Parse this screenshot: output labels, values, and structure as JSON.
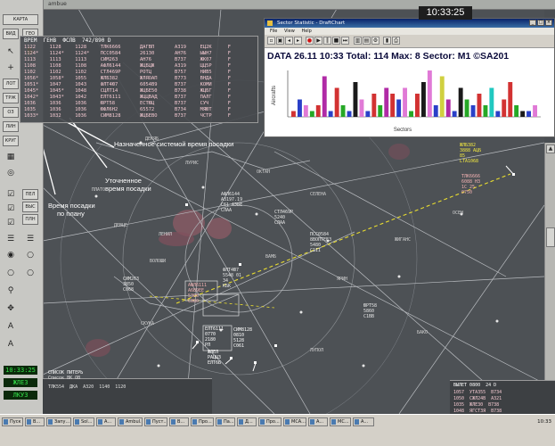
{
  "clock": "10:33:25",
  "top_bar": {
    "title": "ambue",
    "right": ""
  },
  "left_toolbar": {
    "buttons": [
      "КАРТА",
      "ВИД",
      "ГЕО",
      "ЛОТ",
      "ТРЖ",
      "ОЗ",
      "ЛИН",
      "КРУГ",
      "ПЕЛ",
      "ВЫС",
      "ПЛН"
    ],
    "clock_lines": [
      "10:33:25",
      "ЖЛЕЗ",
      "ЛКУЗ"
    ]
  },
  "landing_table": {
    "header": "ВРЕМ  ГЕНВ  ФСЛВ  742/890 D",
    "rows": [
      [
        "1122",
        "1128",
        "1128",
        "ТЛК6666",
        "ДАГВП",
        "A319",
        "ЕЦ2К",
        "F"
      ],
      [
        "1124*",
        "1124*",
        "1124*",
        "ПСС0584",
        "26130",
        "AH76",
        "ЫЫН7",
        "F"
      ],
      [
        "1113",
        "1113",
        "1113",
        "СИМ263",
        "AH76",
        "B737",
        "ЖК07",
        "F"
      ],
      [
        "1108",
        "1108",
        "1108",
        "АФЛ6144",
        "ЖЦБЦЖ",
        "A319",
        "ЦЦ5Р",
        "F"
      ],
      [
        "1102",
        "1102",
        "1102",
        "СТЛ469Р",
        "РОТЦ",
        "B757",
        "НИВ5",
        "F"
      ],
      [
        "1056*",
        "1058*",
        "1055",
        "ЖЛБ382",
        "ЖЛЯОАП",
        "B773",
        "ВНДА",
        "F"
      ],
      [
        "1051*",
        "1047",
        "1043",
        "ФЛТ4Ю7",
        "6054В9",
        "B737",
        "КОМИ",
        "F"
      ],
      [
        "1045*",
        "1045*",
        "1048",
        "СЦЛТ14",
        "ЖЦБЕ50",
        "B738",
        "ЖЦБГ",
        "F"
      ],
      [
        "1042*",
        "1043*",
        "1042",
        "ЕЛТ6111",
        "ЖЦЦВАД",
        "B737",
        "ПАЛГ",
        "F"
      ],
      [
        "1036",
        "1036",
        "1036",
        "ЮРТ58",
        "ЕСТЮЦ",
        "B737",
        "СУЧ",
        "F"
      ],
      [
        "1035",
        "1036",
        "1036",
        "ЮФЛ6Н2",
        "65572",
        "B734",
        "МЯЮТ",
        "F"
      ],
      [
        "1033*",
        "1032",
        "1036",
        "СИМ8128",
        "ЖЦБЕВО",
        "B737",
        "ЧСТР",
        "F"
      ]
    ]
  },
  "annotations": {
    "assigned_system": "Назначенное системой время посадки",
    "refined": [
      "Уточненное",
      "время посадки"
    ],
    "plan_time": [
      "Время посадки",
      "по плану"
    ]
  },
  "stats_window": {
    "title": "Sector Statistic - DraftChart",
    "menu": [
      "File",
      "View",
      "Help"
    ],
    "info": "DATA 26.11 10:33  Total: 114   Max: 8  Sector: M1       ©SA201"
  },
  "chart_data": {
    "type": "bar",
    "xlabel": "Sectors",
    "ylabel": "Aircrafts",
    "values": [
      1,
      3,
      2,
      1,
      2,
      7,
      1,
      5,
      2,
      1,
      6,
      3,
      1,
      4,
      2,
      5,
      4,
      3,
      5,
      1,
      4,
      6,
      8,
      2,
      7,
      3,
      1,
      5,
      3,
      2,
      4,
      2,
      5,
      1,
      3,
      6,
      2,
      1,
      1,
      2
    ],
    "colors": [
      "#d23232",
      "#2a40c8",
      "#e07ad6",
      "#26a826",
      "#d23232",
      "#b02aa6",
      "#2a40c8",
      "#d23232",
      "#26a826",
      "#2a40c8",
      "#1a1a1a",
      "#e07ad6",
      "#2a40c8",
      "#d23232",
      "#26a826",
      "#b02aa6",
      "#d23232",
      "#2a40c8",
      "#e07ad6",
      "#26a826",
      "#d23232",
      "#1a1a1a",
      "#e07ad6",
      "#2a40c8",
      "#d0d040",
      "#b02aa6",
      "#2a40c8",
      "#1a1a1a",
      "#26a826",
      "#2a40c8",
      "#d23232",
      "#26a826",
      "#20c8c0",
      "#2a40c8",
      "#d23232",
      "#d23232",
      "#26a826",
      "#1a1a1a",
      "#2a40c8",
      "#e07ad6"
    ],
    "ylim": [
      0,
      8
    ]
  },
  "radar_labels": [
    {
      "text": "ЖЛБ382\n3888 АЦБ\n85\nLTA1068",
      "cls": "yellow"
    },
    {
      "text": "ТЛК6666\n6088 НЗ\n1С 25\n0750",
      "cls": "pink"
    },
    {
      "text": "АФЛ6144\nА3197.19\nC61 АЭВЕ\nCЛАА",
      "cls": ""
    },
    {
      "text": "СТЛ469Р\n5240\nCЛАА",
      "cls": ""
    },
    {
      "text": "ПСС0584\n8ВОПТЕЕЗ\n5480\nC1II",
      "cls": ""
    },
    {
      "text": "ФЛТ4Ю7\n5548 01\n34\nКБК",
      "cls": ""
    },
    {
      "text": "АФЛ6111\nA6В9ЕЕ\n5308\nC080",
      "cls": "pink"
    },
    {
      "text": "ЕЛТ6111\n0770\n2180\nРЛ",
      "cls": "white"
    },
    {
      "text": "СИМ8128\n0810\n5128\nC061",
      "cls": "white"
    },
    {
      "text": "ЖЛЕЛ\nРАЦЦЗ\nEЛТ6Б",
      "cls": "white"
    },
    {
      "text": "СИМ263\n3850\nС068",
      "cls": ""
    },
    {
      "text": "ЮРТ58\n5860\nС1ВВ",
      "cls": ""
    }
  ],
  "places": [
    "ДЕКЯБ",
    "ПЛАТО",
    "ЛЕНИЛ",
    "СЕЛЕНА",
    "ВАМБ",
    "ЯРИН",
    "ЖИГАНС",
    "ВОЛОШИ",
    "ОСЕН",
    "СКУКА",
    "ЛУПОЛ",
    "ДЕВЦЕ",
    "БАКО",
    "ОКТАН",
    "ЛУРИС"
  ],
  "list_mid": {
    "title": "СПИСОК ПИТЕРЬ",
    "rows": [
      "ТЛК554  ДКА  A320  1140  1120",
      "Список ВК ОВ"
    ]
  },
  "list_right": {
    "title": "ВЫЛЕТ 0800  24 D",
    "rows": [
      "1057  УТА355  B734",
      "1050  СЖЛ24В  A321",
      "1035  ЖЛЕЗ0  B738",
      "1048  ЯГСТЗЯ  B738"
    ]
  },
  "taskbar": {
    "items": [
      "Пуск",
      "В...",
      "Запу...",
      "Sol...",
      "А...",
      "Ambul...",
      "Пуст...",
      "В...",
      "Про...",
      "Па...",
      "Д...",
      "Про...",
      "MCA...",
      "A...",
      "МС...",
      "A..."
    ],
    "time": "10:33"
  }
}
